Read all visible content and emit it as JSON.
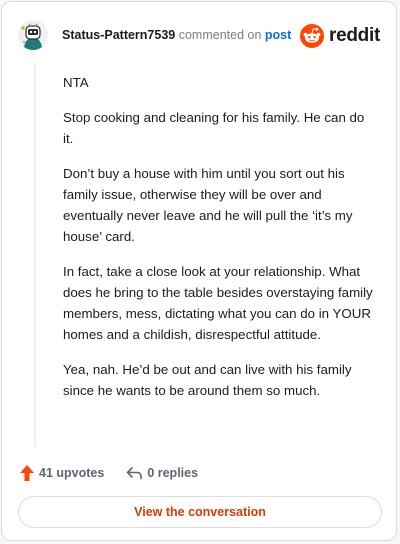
{
  "header": {
    "username": "Status-Pattern7539",
    "commented_text": "commented on",
    "post_link": "post",
    "brand_wordmark": "reddit"
  },
  "comment": {
    "paragraphs": [
      "NTA",
      "Stop cooking and cleaning for his family. He can do it.",
      "Don’t buy a house with him until you sort out his family issue, otherwise they will be over and eventually never leave and he will pull the ‘it’s my house’ card.",
      "In fact, take a close look at your relationship. What does he bring to the table besides overstaying family members, mess, dictating what you can do in YOUR homes and a childish, disrespectful attitude.",
      "Yea, nah. He’d be out and can live with his family since he wants to be around them so much."
    ]
  },
  "actions": {
    "upvotes": "41 upvotes",
    "replies": "0 replies",
    "view_conversation": "View the conversation"
  },
  "colors": {
    "accent": "#d93a00",
    "upvote_arrow": "#ff4500",
    "link": "#0a6ed6",
    "reddit_orange": "#ff4500"
  },
  "icons": {
    "avatar": "snoo-avatar-icon",
    "brand": "reddit-logo-icon",
    "upvote": "upvote-arrow-icon",
    "reply": "reply-arrow-icon"
  }
}
